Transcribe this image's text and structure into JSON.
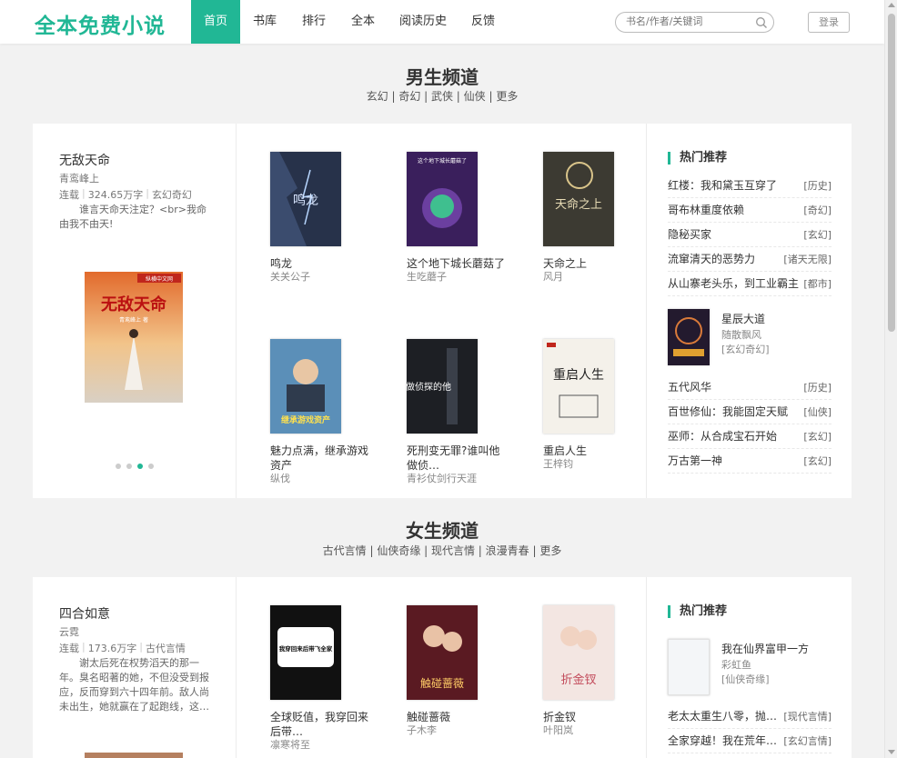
{
  "header": {
    "logo": "全本免费小说",
    "nav": [
      "首页",
      "书库",
      "排行",
      "全本",
      "阅读历史",
      "反馈"
    ],
    "search_placeholder": "书名/作者/关键词",
    "login": "登录"
  },
  "male": {
    "title": "男生频道",
    "subtitle": "玄幻 | 奇幻 | 武侠 | 仙侠 | 更多",
    "feature": {
      "title": "无敌天命",
      "author": "青鸾峰上",
      "status": "连载",
      "words": "324.65万字",
      "category": "玄幻奇幻",
      "desc": "谁言天命天注定？<br>我命由我不由天!",
      "cover_text": "无敌天命",
      "cover_badge": "纵横中文网",
      "cover_author": "青鸾峰上 著"
    },
    "books": [
      {
        "title": "鸣龙",
        "author": "关关公子",
        "cover_text": "鸣龙"
      },
      {
        "title": "这个地下城长蘑菇了",
        "author": "生吃蘑子",
        "cover_text": "这个地下城长蘑菇了"
      },
      {
        "title": "天命之上",
        "author": "风月",
        "cover_text": "天命之上"
      },
      {
        "title": "魅力点满，继承游戏资产",
        "author": "纵伐",
        "cover_text": "继承游戏资产"
      },
      {
        "title": "死刑变无罪?谁叫他做侦…",
        "author": "青衫仗剑行天涯",
        "cover_text": "做侦探的他"
      },
      {
        "title": "重启人生",
        "author": "王梓钧",
        "cover_text": "重启人生"
      }
    ],
    "hot": {
      "heading": "热门推荐",
      "rows_top": [
        {
          "name": "红楼：我和黛玉互穿了",
          "cat": "[历史]"
        },
        {
          "name": "哥布林重度依赖",
          "cat": "[奇幻]"
        },
        {
          "name": "隐秘买家",
          "cat": "[玄幻]"
        },
        {
          "name": "流窜清天的恶势力",
          "cat": "[诸天无限]"
        },
        {
          "name": "从山寨老头乐，到工业霸主",
          "cat": "[都市]"
        }
      ],
      "featured": {
        "title": "星辰大道",
        "author": "随散飘风",
        "cat": "[玄幻奇幻]"
      },
      "rows_bottom": [
        {
          "name": "五代风华",
          "cat": "[历史]"
        },
        {
          "name": "百世修仙：我能固定天赋",
          "cat": "[仙侠]"
        },
        {
          "name": "巫师：从合成宝石开始",
          "cat": "[玄幻]"
        },
        {
          "name": "万古第一神",
          "cat": "[玄幻]"
        }
      ]
    }
  },
  "female": {
    "title": "女生频道",
    "subtitle": "古代言情 | 仙侠奇缘 | 现代言情 | 浪漫青春 | 更多",
    "feature": {
      "title": "四合如意",
      "author": "云霓",
      "status": "连载",
      "words": "173.6万字",
      "category": "古代言情",
      "desc": "谢太后死在权势滔天的那一年。臭名昭著的她，不但没受到报应，反而穿到六十四年前。敌人尚未出生，她就赢在了起跑线，这…"
    },
    "books": [
      {
        "title": "全球贬值，我穿回来后带…",
        "author": "凛寒将至",
        "cover_text": "我穿回来后带飞全家"
      },
      {
        "title": "触碰蔷薇",
        "author": "子木李",
        "cover_text": "触碰蔷薇"
      },
      {
        "title": "折金钗",
        "author": "叶阳岚",
        "cover_text": "折金钗"
      }
    ],
    "hot": {
      "heading": "热门推荐",
      "featured": {
        "title": "我在仙界富甲一方",
        "author": "彩虹鱼",
        "cat": "[仙侠奇缘]"
      },
      "rows": [
        {
          "name": "老太太重生八零，抛…",
          "cat": "[现代言情]"
        },
        {
          "name": "全家穿越！我在荒年…",
          "cat": "[玄幻言情]"
        }
      ]
    }
  },
  "colors": {
    "accent": "#21b795",
    "background": "#f2f2f2"
  }
}
